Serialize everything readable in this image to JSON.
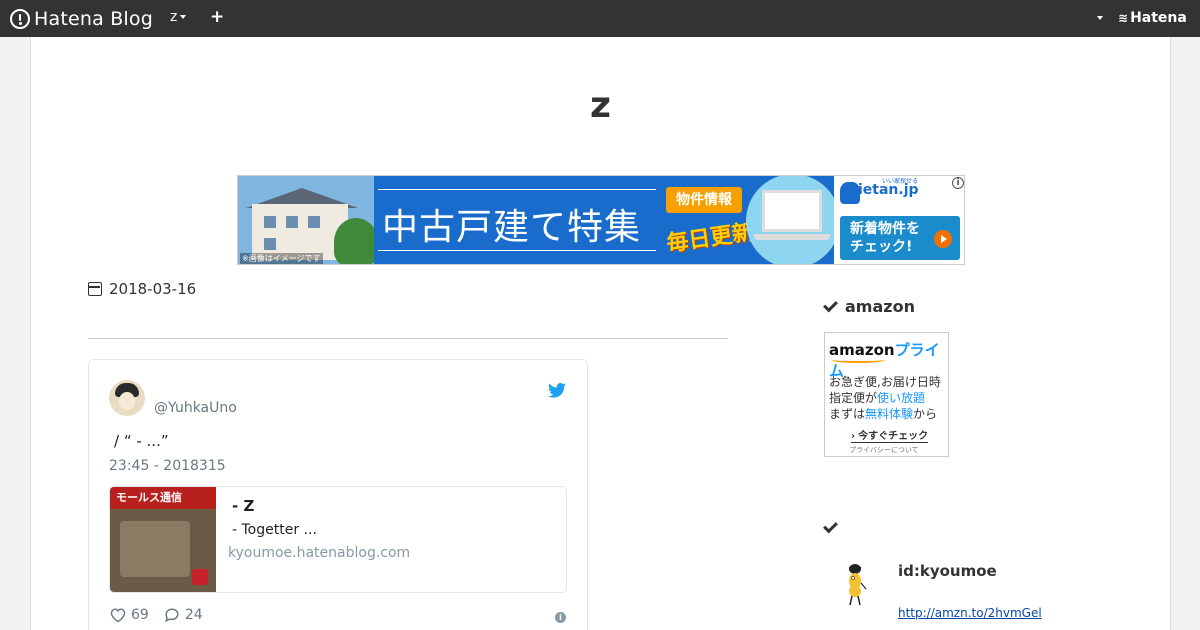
{
  "topbar": {
    "logo_text": "Hatena Blog",
    "blog_switch_label": "z",
    "add_label": "+",
    "brand_label": "Hatena",
    "brand_mark": "≋"
  },
  "blog": {
    "title": "z"
  },
  "banner_ad": {
    "headline": "中古戸建て特集",
    "badge_property": "物件情報",
    "badge_daily": "毎日更新",
    "image_note": "※画像はイメージです",
    "brand_small": "いい家探せる",
    "brand": "ietan.jp",
    "cta_line1": "新着物件を",
    "cta_line2": "チェック!",
    "info_icon": "info-icon",
    "colors": {
      "main": "#1a6ccc",
      "accent": "#f5a000"
    }
  },
  "article": {
    "date": "2018-03-16",
    "date_icon": "calendar-icon"
  },
  "tweet": {
    "handle": "@YuhkaUno",
    "text": " / “ - ...”",
    "timestamp": "23:45 - 2018315",
    "card": {
      "thumb_title": "モールス通信",
      "title": "- Z",
      "description": "- Togetter   ...",
      "domain": "kyoumoe.hatenablog.com"
    },
    "likes": "69",
    "replies": "24",
    "twitter_color": "#1da1f2"
  },
  "sidebar": {
    "amazon_heading": "amazon",
    "prime": {
      "logo_main": "amazon",
      "logo_accent": "プライム",
      "line1": "お急ぎ便,お届け日時",
      "line2_prefix": "指定便が",
      "line2_highlight": "使い放題",
      "line3_prefix": "まずは",
      "line3_highlight": "無料体験",
      "line3_suffix": "から",
      "cta": "今すぐチェック",
      "privacy": "プライバシーについて"
    },
    "profile_heading": "",
    "profile_id": "id:kyoumoe",
    "profile_link": "http://amzn.to/2hvmGel"
  }
}
